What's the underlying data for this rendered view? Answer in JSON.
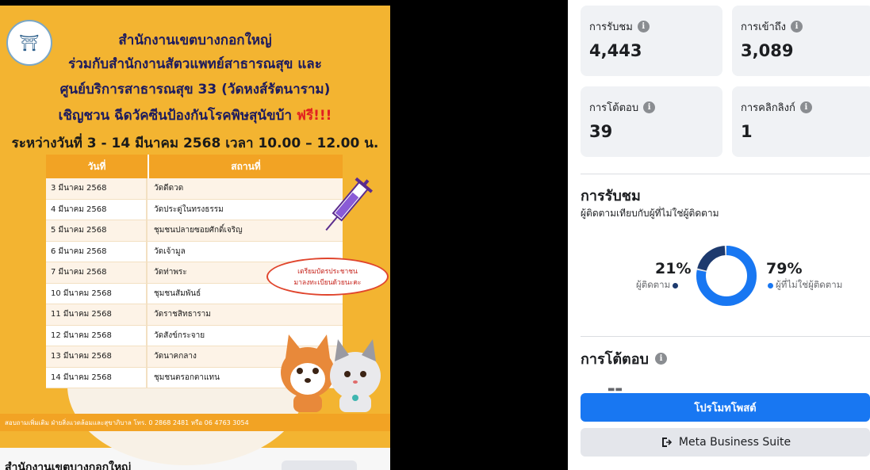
{
  "post": {
    "poster": {
      "line1": "สำนักงานเขตบางกอกใหญ่",
      "line2": "ร่วมกับสำนักงานสัตวแพทย์สาธารณสุข และ",
      "line3": "ศูนย์บริการสาธารณสุข 33 (วัดหงส์รัตนาราม)",
      "line4_main": "เชิญชวน ฉีดวัคซีนป้องกันโรคพิษสุนัขบ้า",
      "line4_free": "ฟรี!!!",
      "line5": "ระหว่างวันที่ 3 - 14 มีนาคม 2568 เวลา 10.00 – 12.00 น.",
      "table_headers": [
        "วันที่",
        "สถานที่"
      ],
      "rows": [
        {
          "date": "3 มีนาคม 2568",
          "place": "วัดดีดวด"
        },
        {
          "date": "4 มีนาคม 2568",
          "place": "วัดประดู่ในทรงธรรม"
        },
        {
          "date": "5 มีนาคม 2568",
          "place": "ชุมชนปลายซอยศักดิ์เจริญ"
        },
        {
          "date": "6 มีนาคม 2568",
          "place": "วัดเจ้ามูล"
        },
        {
          "date": "7 มีนาคม 2568",
          "place": "วัดท่าพระ"
        },
        {
          "date": "10 มีนาคม 2568",
          "place": "ชุมชนสัมพันธ์"
        },
        {
          "date": "11 มีนาคม 2568",
          "place": "วัดราชสิทธาราม"
        },
        {
          "date": "12 มีนาคม 2568",
          "place": "วัดสังข์กระจาย"
        },
        {
          "date": "13 มีนาคม 2568",
          "place": "วัดนาคกลาง"
        },
        {
          "date": "14 มีนาคม 2568",
          "place": "ชุมชนตรอกตาแทน"
        }
      ],
      "bubble_line1": "เตรียมบัตรประชาชน",
      "bubble_line2": "มาลงทะเบียนด้วยนะคะ",
      "footer": "สอบถามเพิ่มเติม ฝ่ายสิ่งแวดล้อมและสุขาภิบาล โทร. 0 2868 2481 หรือ 06 4763 3054"
    },
    "page_name": "สำนักงานเขตบางกอกใหญ่"
  },
  "insights": {
    "cards": [
      {
        "label": "การรับชม",
        "value": "4,443"
      },
      {
        "label": "การเข้าถึง",
        "value": "3,089"
      },
      {
        "label": "การโต้ตอบ",
        "value": "39"
      },
      {
        "label": "การคลิกลิงก์",
        "value": "1"
      }
    ],
    "views_section": {
      "title": "การรับชม",
      "subtitle": "ผู้ติดตามเทียบกับผู้ที่ไม่ใช่ผู้ติดตาม",
      "followers_pct": "21%",
      "followers_label": "ผู้ติดตาม",
      "non_followers_pct": "79%",
      "non_followers_label": "ผู้ที่ไม่ใช่ผู้ติดตาม",
      "followers_value": 21,
      "non_followers_value": 79,
      "colors": {
        "followers": "#1d3a6e",
        "non_followers": "#1877f2"
      }
    },
    "engagement_section": {
      "title": "การโต้ตอบ"
    },
    "buttons": {
      "promote": "โปรโมทโพสต์",
      "business_suite": "Meta Business Suite"
    }
  }
}
